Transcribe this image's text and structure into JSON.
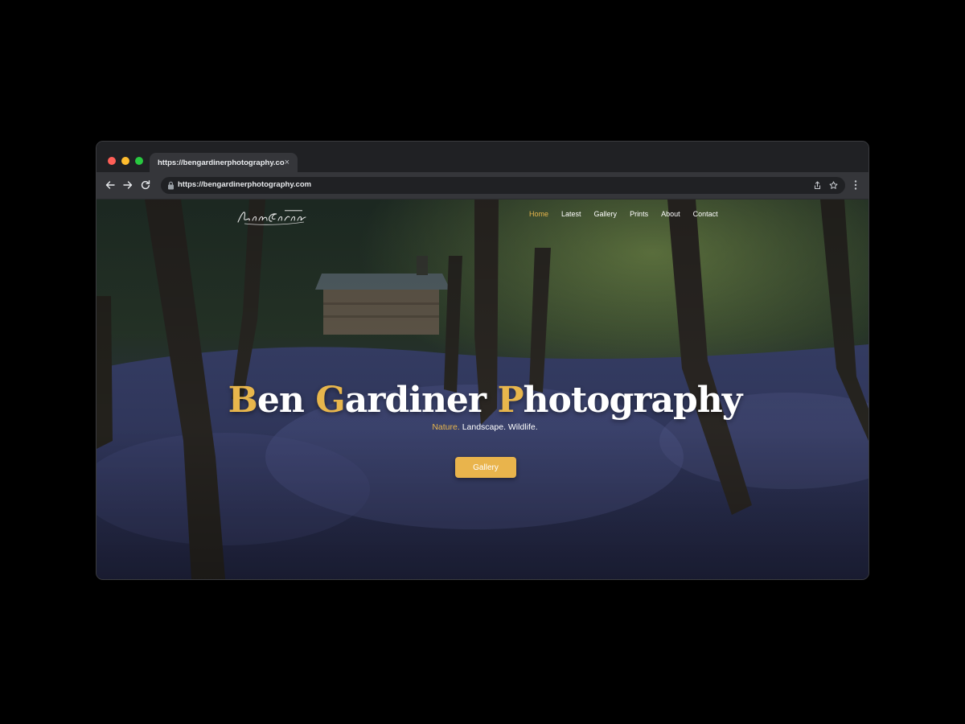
{
  "browser": {
    "tab": {
      "title": "https://bengardinerphotography.com",
      "close_glyph": "×"
    },
    "address_bar": {
      "url": "https://bengardinerphotography.com"
    },
    "colors": {
      "red": "#ff5f57",
      "yellow": "#febc2e",
      "green": "#28c840"
    }
  },
  "site": {
    "logo_icon": "ben-gardiner-signature-logo",
    "nav": [
      {
        "label": "Home",
        "active": true
      },
      {
        "label": "Latest",
        "active": false
      },
      {
        "label": "Gallery",
        "active": false
      },
      {
        "label": "Prints",
        "active": false
      },
      {
        "label": "About",
        "active": false
      },
      {
        "label": "Contact",
        "active": false
      }
    ],
    "hero": {
      "title_words": [
        {
          "initial": "B",
          "rest": "en"
        },
        {
          "initial": "G",
          "rest": "ardiner"
        },
        {
          "initial": "P",
          "rest": "hotography"
        }
      ],
      "tagline_accent": "Nature.",
      "tagline_rest": "Landscape. Wildlife.",
      "cta_label": "Gallery",
      "background": "bluebell-forest-with-wooden-hut"
    },
    "colors": {
      "accent": "#e8b64c",
      "text": "#ffffff"
    }
  }
}
